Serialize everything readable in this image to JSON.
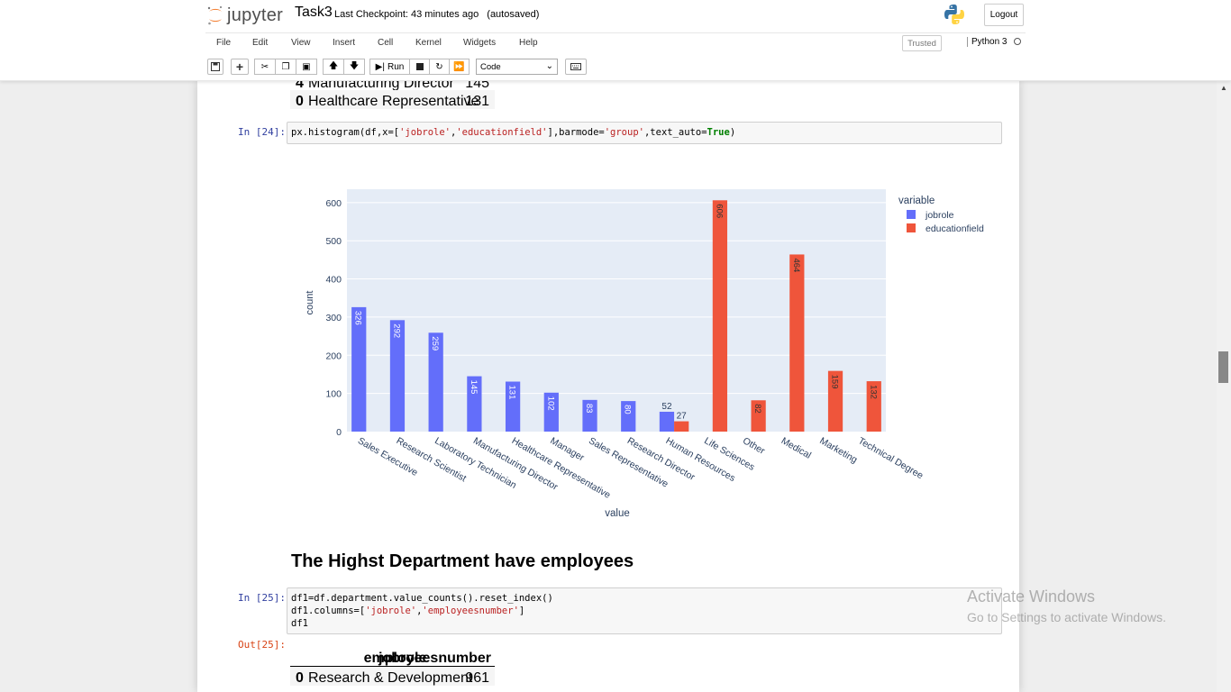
{
  "header": {
    "logo_text": "jupyter",
    "notebook_name": "Task3",
    "checkpoint": "Last Checkpoint: 43 minutes ago",
    "autosave": "(autosaved)",
    "logout_label": "Logout",
    "trusted_label": "Trusted",
    "kernel_name": "Python 3"
  },
  "menu": [
    "File",
    "Edit",
    "View",
    "Insert",
    "Cell",
    "Kernel",
    "Widgets",
    "Help"
  ],
  "toolbar": {
    "run_label": "Run",
    "cell_type": "Code",
    "icons": [
      "save-icon",
      "plus-icon",
      "cut-icon",
      "copy-icon",
      "paste-icon",
      "arrow-up-icon",
      "arrow-down-icon",
      "run-icon",
      "stop-icon",
      "restart-icon",
      "fast-forward-icon",
      "keyboard-icon"
    ]
  },
  "top_table": {
    "rows": [
      {
        "index": "4",
        "name": "Manufacturing Director",
        "value": "145"
      },
      {
        "index": "0",
        "name": "Healthcare Representative",
        "value": "131"
      }
    ]
  },
  "cell24": {
    "prompt": "In [24]:",
    "code": {
      "p1": "px.histogram(df,x=[",
      "s1": "'jobrole'",
      "p2": ",",
      "s2": "'educationfield'",
      "p3": "],barmode=",
      "s3": "'group'",
      "p4": ",text_auto=",
      "kw": "True",
      "p5": ")"
    }
  },
  "chart_data": {
    "type": "bar",
    "xlabel": "value",
    "ylabel": "count",
    "ylim": [
      0,
      635
    ],
    "yticks": [
      0,
      100,
      200,
      300,
      400,
      500,
      600
    ],
    "legend_title": "variable",
    "legend_position": "top-right",
    "grid": true,
    "colors": {
      "jobrole": "#636efa",
      "educationfield": "#ef553b",
      "plot_bg": "#e5ecf6"
    },
    "categories": [
      "Sales Executive",
      "Research Scientist",
      "Laboratory Technician",
      "Manufacturing Director",
      "Healthcare Representative",
      "Manager",
      "Sales Representative",
      "Research Director",
      "Human Resources",
      "Life Sciences",
      "Other",
      "Medical",
      "Marketing",
      "Technical Degree"
    ],
    "series": [
      {
        "name": "jobrole",
        "values": [
          326,
          292,
          259,
          145,
          131,
          102,
          83,
          80,
          52,
          null,
          null,
          null,
          null,
          null
        ]
      },
      {
        "name": "educationfield",
        "values": [
          null,
          null,
          null,
          null,
          null,
          null,
          null,
          null,
          27,
          606,
          82,
          464,
          159,
          132
        ]
      }
    ]
  },
  "markdown_heading": "The Highst Department have employees",
  "cell25": {
    "prompt_in": "In [25]:",
    "prompt_out": "Out[25]:",
    "line1": "df1=df.department.value_counts().reset_index()",
    "line2a": "df1.columns=[",
    "line2s1": "'jobrole'",
    "line2c": ",",
    "line2s2": "'employeesnumber'",
    "line2b": "]",
    "line3": "df1"
  },
  "out_table": {
    "columns": [
      "jobrole",
      "employeesnumber"
    ],
    "rows": [
      {
        "index": "0",
        "name": "Research & Development",
        "value": "961"
      }
    ]
  },
  "watermark": {
    "title": "Activate Windows",
    "subtitle": "Go to Settings to activate Windows."
  }
}
